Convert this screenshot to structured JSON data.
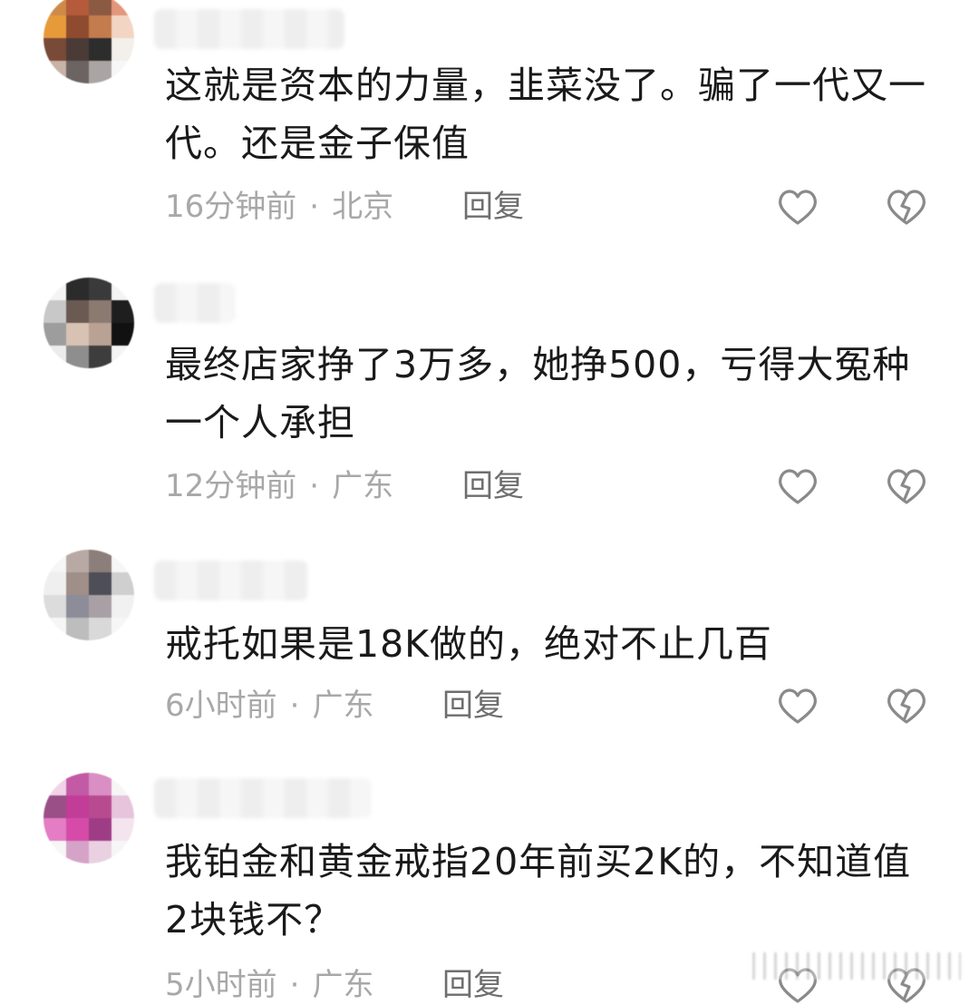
{
  "comments": [
    {
      "text": "这就是资本的力量，韭菜没了。骗了一代又一代。还是金子保值",
      "time": "16分钟前",
      "location": "北京",
      "reply_label": "回复",
      "like_icon": "heart-outline-icon",
      "dislike_icon": "broken-heart-icon"
    },
    {
      "text": "最终店家挣了3万多，她挣500，亏得大冤种一个人承担",
      "time": "12分钟前",
      "location": "广东",
      "reply_label": "回复",
      "like_icon": "heart-outline-icon",
      "dislike_icon": "broken-heart-icon"
    },
    {
      "text": "戒托如果是18K做的，绝对不止几百",
      "time": "6小时前",
      "location": "广东",
      "reply_label": "回复",
      "like_icon": "heart-outline-icon",
      "dislike_icon": "broken-heart-icon"
    },
    {
      "text": "我铂金和黄金戒指20年前买2K的，不知道值2块钱不？",
      "time": "5小时前",
      "location": "广东",
      "reply_label": "回复",
      "like_icon": "heart-outline-icon",
      "dislike_icon": "broken-heart-icon"
    }
  ],
  "separator": "·",
  "colors": {
    "text": "#1a1a1a",
    "meta": "#a8a8a8",
    "reply": "#6e6e6e",
    "icon_stroke": "#8a8a8a"
  }
}
